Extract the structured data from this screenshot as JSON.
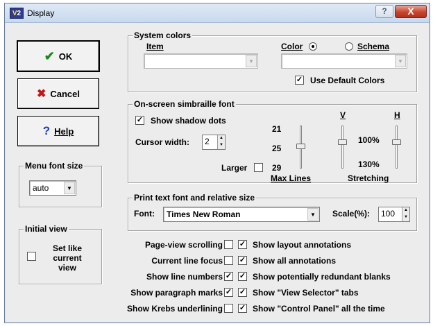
{
  "window": {
    "title": "Display",
    "icon_name": "v2-app-icon",
    "help_glyph": "?",
    "close_glyph": "X"
  },
  "buttons": {
    "ok": "OK",
    "cancel": "Cancel",
    "help": "Help"
  },
  "menu_font": {
    "legend": "Menu font size",
    "value": "auto"
  },
  "initial_view": {
    "legend": "Initial view",
    "checkbox_label": "Set like current view"
  },
  "system_colors": {
    "legend": "System colors",
    "item_label": "Item",
    "item_value": "",
    "color_radio": "Color",
    "schema_radio": "Schema",
    "color_value": "",
    "use_default": "Use Default Colors",
    "use_default_checked": true
  },
  "simbraille": {
    "legend": "On-screen simbraille font",
    "show_shadow": "Show shadow dots",
    "show_shadow_checked": true,
    "cursor_width_label": "Cursor width:",
    "cursor_width_value": "2",
    "larger_label": "Larger",
    "larger_checked": false,
    "max_lines_label": "Max Lines",
    "max_lines_ticks": [
      "21",
      "25",
      "29"
    ],
    "stretching_label": "Stretching",
    "v_label": "V",
    "h_label": "H",
    "stretch_ticks": [
      "100%",
      "130%"
    ]
  },
  "print_font": {
    "legend": "Print text font and relative size",
    "font_label": "Font:",
    "font_value": "Times New Roman",
    "scale_label": "Scale(%):",
    "scale_value": "100"
  },
  "options_left": [
    {
      "label": "Page-view scrolling",
      "checked": false
    },
    {
      "label": "Current line focus",
      "checked": false
    },
    {
      "label": "Show line numbers",
      "checked": true
    },
    {
      "label": "Show paragraph marks",
      "checked": true
    },
    {
      "label": "Show Krebs underlining",
      "checked": false
    }
  ],
  "options_right": [
    {
      "label": "Show layout annotations",
      "checked": true
    },
    {
      "label": "Show all annotations",
      "checked": true
    },
    {
      "label": "Show potentially redundant blanks",
      "checked": true
    },
    {
      "label": "Show \"View Selector\" tabs",
      "checked": true
    },
    {
      "label": "Show \"Control Panel\" all the time",
      "checked": true
    }
  ],
  "glyphs": {
    "check": "✔",
    "checkmark_box": "✓",
    "cross": "✖",
    "question": "?",
    "down_arrow": "▼",
    "up_arrow": "▲"
  }
}
